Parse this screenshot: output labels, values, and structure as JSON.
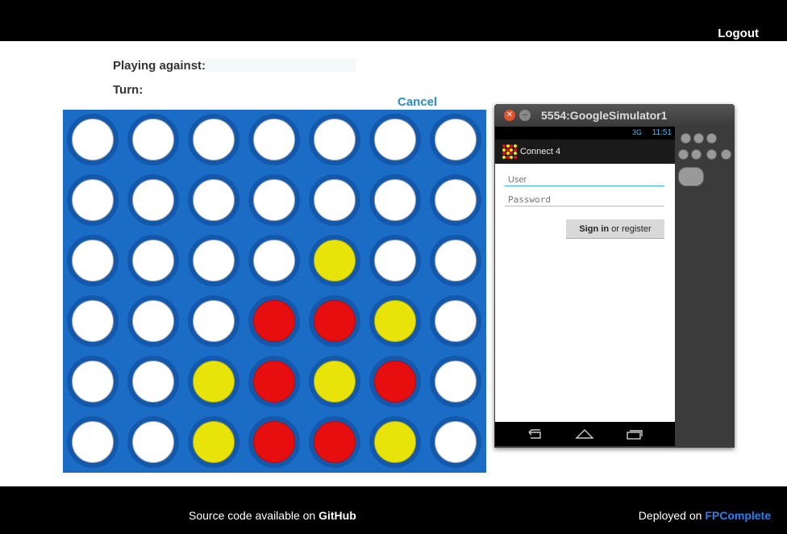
{
  "header": {
    "logout_label": "Logout"
  },
  "game": {
    "playing_against_label": "Playing against:",
    "opponent": "",
    "turn_label": "Turn:",
    "turn_value": "",
    "cancel_label": "Cancel",
    "board": {
      "columns": 7,
      "rows": 6,
      "cells": [
        [
          "empty",
          "empty",
          "empty",
          "empty",
          "empty",
          "empty",
          "empty"
        ],
        [
          "empty",
          "empty",
          "empty",
          "empty",
          "empty",
          "empty",
          "empty"
        ],
        [
          "empty",
          "empty",
          "empty",
          "empty",
          "yellow",
          "empty",
          "empty"
        ],
        [
          "empty",
          "empty",
          "empty",
          "red",
          "red",
          "yellow",
          "empty"
        ],
        [
          "empty",
          "empty",
          "yellow",
          "red",
          "yellow",
          "red",
          "empty"
        ],
        [
          "empty",
          "empty",
          "yellow",
          "red",
          "red",
          "yellow",
          "empty"
        ]
      ]
    },
    "colors": {
      "board": "#1b6cc4",
      "red": "#e60e0e",
      "yellow": "#e8e40a",
      "empty": "#ffffff"
    }
  },
  "emulator": {
    "window_title": "5554:GoogleSimulator1",
    "status": {
      "signal": "3G",
      "time": "11:51"
    },
    "app_title": "Connect 4",
    "user_placeholder": "User",
    "password_placeholder": "Password",
    "signin_bold": "Sign in",
    "signin_rest": " or register",
    "nav_icons": [
      "back-icon",
      "home-icon",
      "recent-apps-icon"
    ]
  },
  "footer": {
    "source_prefix": "Source code available on ",
    "github_label": "GitHub",
    "deployed_prefix": "Deployed on ",
    "fpcomplete_label": "FPComplete"
  }
}
